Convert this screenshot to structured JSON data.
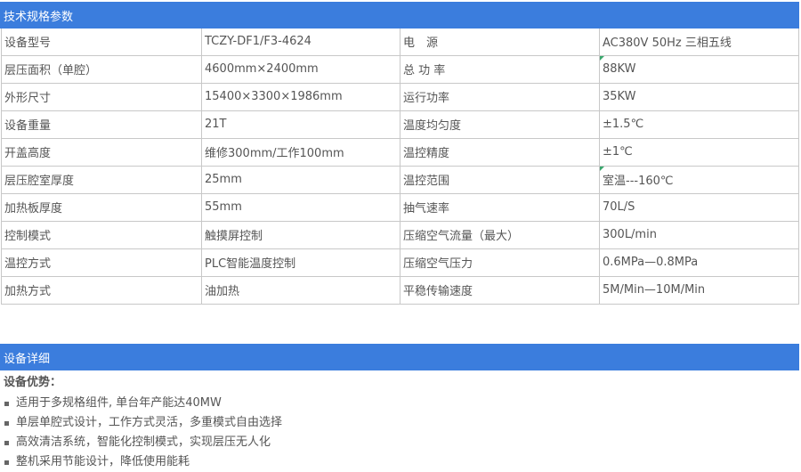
{
  "spec_section": {
    "title": "技术规格参数"
  },
  "spec_rows": [
    {
      "l1": "设备型号",
      "v1": "TCZY-DF1/F3-4624",
      "l2": "电　源",
      "v2": "AC380V 50Hz 三相五线"
    },
    {
      "l1": "层压面积（单腔）",
      "v1": "4600mm×2400mm",
      "l2": "总 功 率",
      "v2": "88KW"
    },
    {
      "l1": "外形尺寸",
      "v1": "15400×3300×1986mm",
      "l2": "运行功率",
      "v2": "35KW"
    },
    {
      "l1": "设备重量",
      "v1": "21T",
      "l2": "温度均匀度",
      "v2": "±1.5℃"
    },
    {
      "l1": "开盖高度",
      "v1": "维修300mm/工作100mm",
      "l2": "温控精度",
      "v2": "±1℃"
    },
    {
      "l1": "层压腔室厚度",
      "v1": "25mm",
      "l2": "温控范围",
      "v2": "室温---160℃"
    },
    {
      "l1": "加热板厚度",
      "v1": "55mm",
      "l2": "抽气速率",
      "v2": "70L/S"
    },
    {
      "l1": "控制模式",
      "v1": "触摸屏控制",
      "l2": "压缩空气流量（最大）",
      "v2": "300L/min"
    },
    {
      "l1": "温控方式",
      "v1": "PLC智能温度控制",
      "l2": "压缩空气压力",
      "v2": "0.6MPa—0.8MPa"
    },
    {
      "l1": "加热方式",
      "v1": "油加热",
      "l2": "平稳传输速度",
      "v2": "5M/Min—10M/Min"
    }
  ],
  "detail_section": {
    "title": "设备详细",
    "advantages_title": "设备优势：",
    "advantages": [
      "适用于多规格组件, 单台年产能达40MW",
      "单层单腔式设计，工作方式灵活，多重模式自由选择",
      "高效清洁系统，智能化控制模式，实现层压无人化",
      "整机采用节能设计，降低使用能耗"
    ]
  },
  "colors": {
    "header_bar": "#3b7ddd",
    "grid_line": "#c8c8c8",
    "text": "#555555",
    "corner_flag": "#3aa76d"
  }
}
